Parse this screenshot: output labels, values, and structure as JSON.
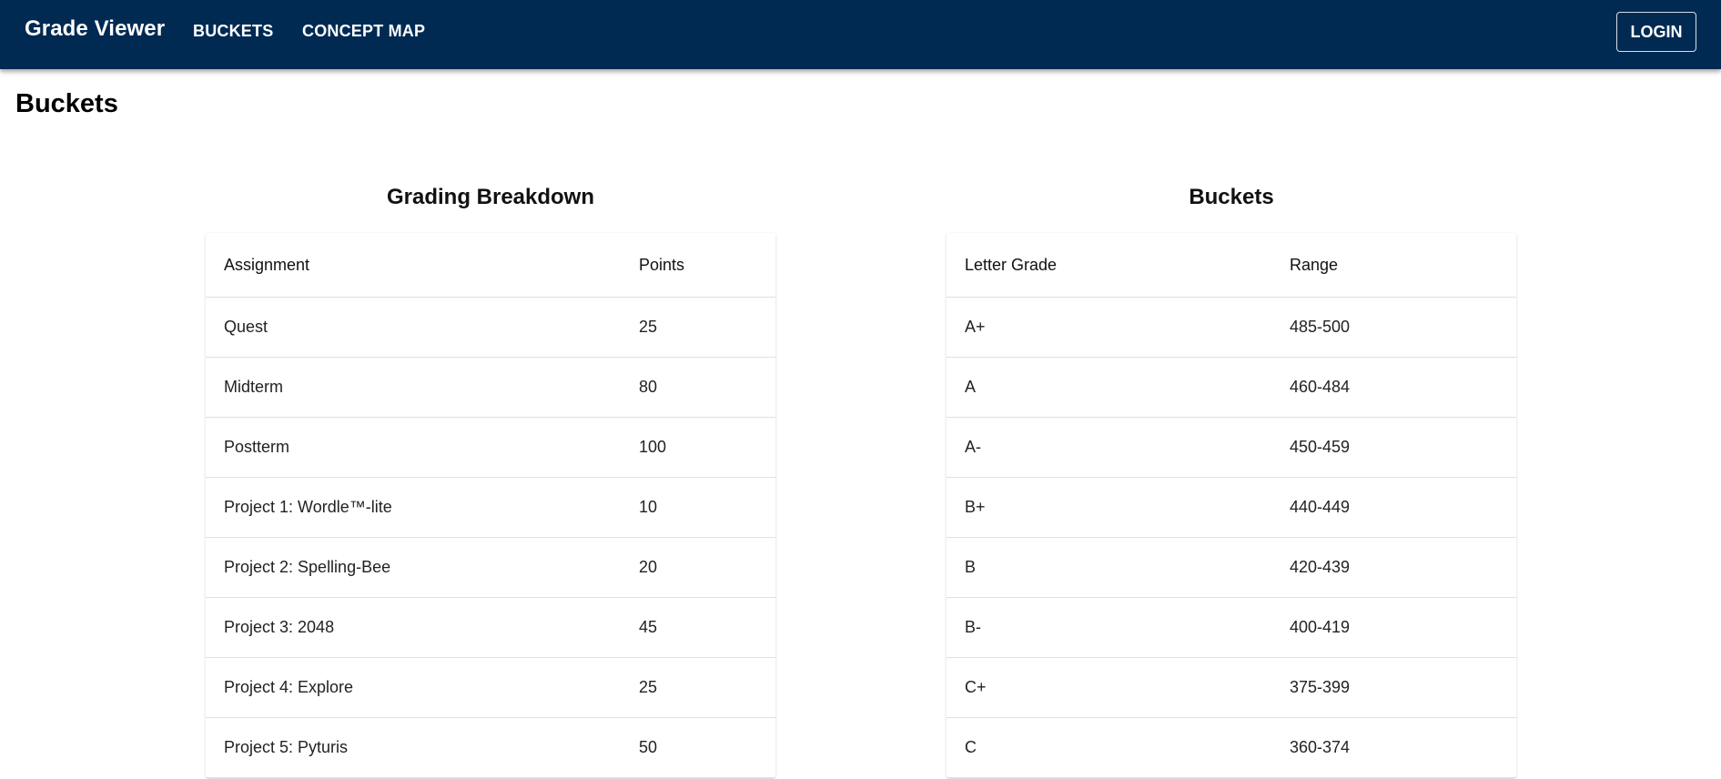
{
  "header": {
    "brand": "Grade Viewer",
    "nav": [
      "BUCKETS",
      "CONCEPT MAP"
    ],
    "login_label": "LOGIN",
    "background_color": "#002a52"
  },
  "page": {
    "title": "Buckets"
  },
  "grading_breakdown": {
    "title": "Grading Breakdown",
    "columns": [
      "Assignment",
      "Points"
    ],
    "rows": [
      [
        "Quest",
        "25"
      ],
      [
        "Midterm",
        "80"
      ],
      [
        "Postterm",
        "100"
      ],
      [
        "Project 1: Wordle™-lite",
        "10"
      ],
      [
        "Project 2: Spelling-Bee",
        "20"
      ],
      [
        "Project 3: 2048",
        "45"
      ],
      [
        "Project 4: Explore",
        "25"
      ],
      [
        "Project 5: Pyturis",
        "50"
      ]
    ]
  },
  "buckets": {
    "title": "Buckets",
    "columns": [
      "Letter Grade",
      "Range"
    ],
    "rows": [
      [
        "A+",
        "485-500"
      ],
      [
        "A",
        "460-484"
      ],
      [
        "A-",
        "450-459"
      ],
      [
        "B+",
        "440-449"
      ],
      [
        "B",
        "420-439"
      ],
      [
        "B-",
        "400-419"
      ],
      [
        "C+",
        "375-399"
      ],
      [
        "C",
        "360-374"
      ]
    ]
  }
}
